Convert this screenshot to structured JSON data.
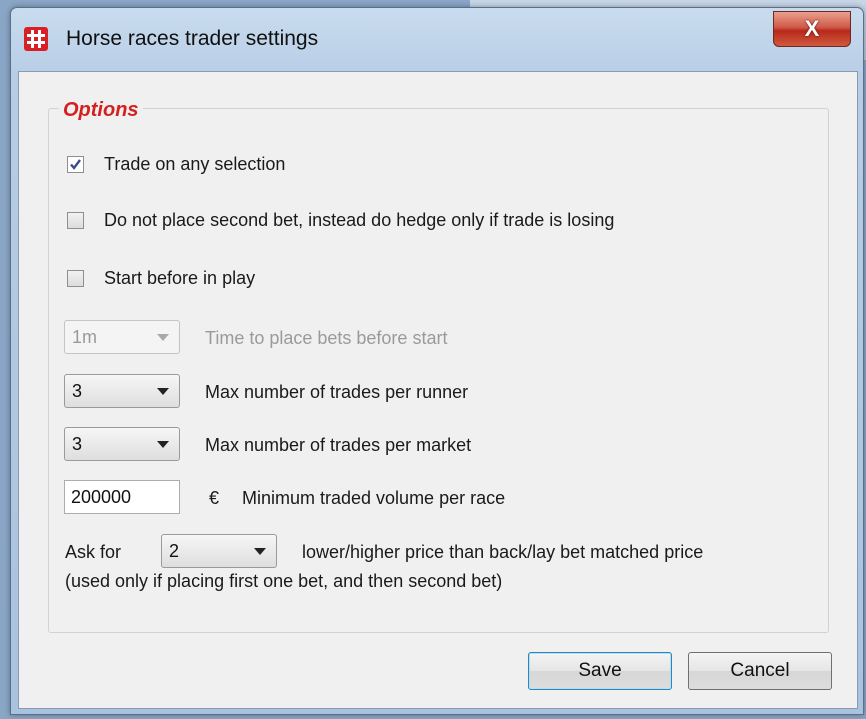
{
  "window": {
    "title": "Horse races trader settings",
    "close_glyph": "X"
  },
  "options": {
    "group_title": "Options",
    "trade_any_selection": {
      "label": "Trade on any selection",
      "checked": true
    },
    "hedge_only": {
      "label": "Do not place second bet, instead do hedge only if trade is losing",
      "checked": false
    },
    "start_before_in_play": {
      "label": "Start before in play",
      "checked": false
    },
    "time_before_start": {
      "value": "1m",
      "label": "Time to place bets before start",
      "enabled": false
    },
    "max_trades_runner": {
      "value": "3",
      "label": "Max number of trades per runner"
    },
    "max_trades_market": {
      "value": "3",
      "label": "Max number of trades per market"
    },
    "min_volume": {
      "value": "200000",
      "currency": "€",
      "label": "Minimum traded volume per race"
    },
    "ask_for": {
      "prefix": "Ask for",
      "value": "2",
      "suffix": "lower/higher price than back/lay bet matched price",
      "note": "(used only if placing first one bet, and then second bet)"
    }
  },
  "buttons": {
    "save": "Save",
    "cancel": "Cancel"
  },
  "colors": {
    "group_title": "#d52020",
    "close_button": "#c8402e"
  }
}
